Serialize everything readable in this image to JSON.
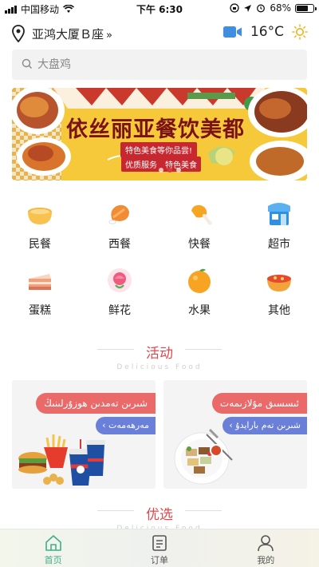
{
  "status_bar": {
    "carrier": "中国移动",
    "time": "下午 6:30",
    "battery": "68%",
    "battery_level": 0.68
  },
  "location": {
    "address": "亚鸿大厦Ｂ座",
    "arrow": "»",
    "temperature": "16°C"
  },
  "search": {
    "placeholder": "大盘鸡"
  },
  "banner": {
    "title": "依丝丽亚餐饮美都",
    "subtitle": "特色美食等你品尝!",
    "tags": [
      "优质服务",
      "特色美食"
    ],
    "slide_count": 3,
    "active_slide": 1
  },
  "categories": [
    {
      "label": "民餐",
      "icon": "soup-bowl-icon"
    },
    {
      "label": "西餐",
      "icon": "chicken-leg-icon"
    },
    {
      "label": "快餐",
      "icon": "drumstick-icon"
    },
    {
      "label": "超市",
      "icon": "store-icon"
    },
    {
      "label": "蛋糕",
      "icon": "cake-icon"
    },
    {
      "label": "鲜花",
      "icon": "flower-icon"
    },
    {
      "label": "水果",
      "icon": "orange-icon"
    },
    {
      "label": "其他",
      "icon": "food-bowl-icon"
    }
  ],
  "activity_section": {
    "title": "活动",
    "subtitle": "Delicious Food"
  },
  "activity_cards": [
    {
      "title": "شىرىن تەمدىن ھوزۇرلىنىڭ",
      "action": "مەرھەمەت"
    },
    {
      "title": "ئىسسىق مۇلازىمەت",
      "action": "شىرىن تەم بارايدۇ"
    }
  ],
  "featured_section": {
    "title": "优选",
    "subtitle": "Delicious Food"
  },
  "tab_bar": [
    {
      "label": "首页",
      "icon": "home-icon",
      "active": true
    },
    {
      "label": "订单",
      "icon": "order-list-icon",
      "active": false
    },
    {
      "label": "我的",
      "icon": "user-icon",
      "active": false
    }
  ],
  "colors": {
    "accent": "#e0474c",
    "active_tab": "#3fae8c",
    "pill_red": "#ea6a6a",
    "pill_blue": "#6a7fd8",
    "banner_bg": "#f6c93a"
  }
}
